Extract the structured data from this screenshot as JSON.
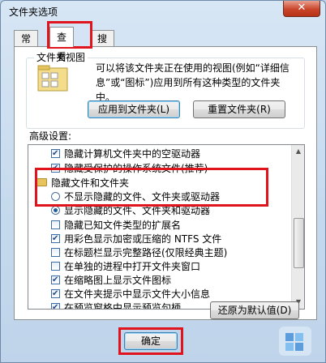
{
  "window": {
    "title": "文件夹选项",
    "close_glyph": "✕"
  },
  "tabs": [
    {
      "label": "常规"
    },
    {
      "label": "查看"
    },
    {
      "label": "搜索"
    }
  ],
  "folder_views": {
    "group_title": "文件夹视图",
    "description": "可以将该文件夹正在使用的视图(例如“详细信息”或“图标”)应用到所有这种类型的文件夹中。",
    "apply_button": "应用到文件夹(L)",
    "reset_button": "重置文件夹(R)"
  },
  "advanced": {
    "label": "高级设置:",
    "rows": [
      {
        "type": "checkbox",
        "checked": true,
        "text": "隐藏计算机文件夹中的空驱动器"
      },
      {
        "type": "checkbox",
        "checked": true,
        "text": "隐藏受保护的操作系统文件(推荐)"
      },
      {
        "type": "folder",
        "text": "隐藏文件和文件夹"
      },
      {
        "type": "radio",
        "checked": false,
        "text": "不显示隐藏的文件、文件夹或驱动器"
      },
      {
        "type": "radio",
        "checked": true,
        "text": "显示隐藏的文件、文件夹和驱动器"
      },
      {
        "type": "checkbox",
        "checked": false,
        "text": "隐藏已知文件类型的扩展名"
      },
      {
        "type": "checkbox",
        "checked": true,
        "text": "用彩色显示加密或压缩的 NTFS 文件"
      },
      {
        "type": "checkbox",
        "checked": false,
        "text": "在标题栏显示完整路径(仅限经典主题)"
      },
      {
        "type": "checkbox",
        "checked": false,
        "text": "在单独的进程中打开文件夹窗口"
      },
      {
        "type": "checkbox",
        "checked": true,
        "text": "在缩略图上显示文件图标"
      },
      {
        "type": "checkbox",
        "checked": true,
        "text": "在文件夹提示中显示文件大小信息"
      },
      {
        "type": "checkbox",
        "checked": true,
        "text": "在预览窗格中显示预览句柄"
      }
    ],
    "restore_button": "还原为默认值(D)"
  },
  "footer": {
    "ok_button": "确定"
  },
  "colors": {
    "highlight": "#e0141d",
    "title_bg": "#c5d9ee"
  }
}
